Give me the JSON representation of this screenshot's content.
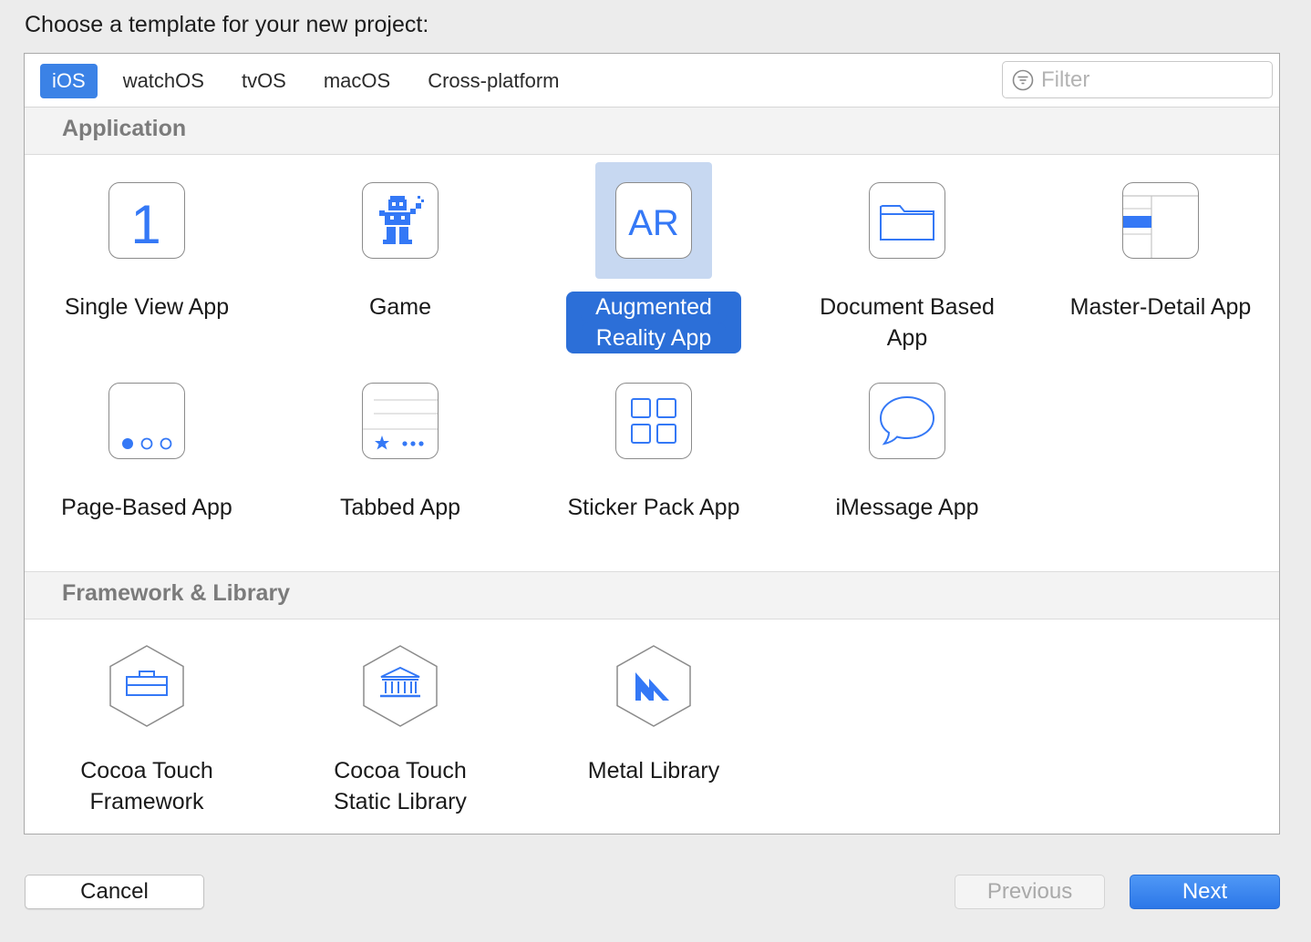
{
  "prompt": "Choose a template for your new project:",
  "tabs": [
    {
      "label": "iOS",
      "active": true
    },
    {
      "label": "watchOS",
      "active": false
    },
    {
      "label": "tvOS",
      "active": false
    },
    {
      "label": "macOS",
      "active": false
    },
    {
      "label": "Cross-platform",
      "active": false
    }
  ],
  "filter": {
    "placeholder": "Filter",
    "value": ""
  },
  "sections": {
    "application": {
      "title": "Application",
      "items": [
        {
          "line1": "Single View App",
          "line2": "",
          "icon": "single-view-icon",
          "glyph": "1"
        },
        {
          "line1": "Game",
          "line2": "",
          "icon": "game-icon"
        },
        {
          "line1": "Augmented",
          "line2": "Reality App",
          "icon": "ar-icon",
          "glyph": "AR",
          "selected": true
        },
        {
          "line1": "Document Based",
          "line2": "App",
          "icon": "folder-icon"
        },
        {
          "line1": "Master-Detail App",
          "line2": "",
          "icon": "master-detail-icon"
        },
        {
          "line1": "Page-Based App",
          "line2": "",
          "icon": "page-dots-icon"
        },
        {
          "line1": "Tabbed App",
          "line2": "",
          "icon": "tab-bar-icon"
        },
        {
          "line1": "Sticker Pack App",
          "line2": "",
          "icon": "sticker-grid-icon"
        },
        {
          "line1": "iMessage App",
          "line2": "",
          "icon": "speech-bubble-icon"
        }
      ]
    },
    "framework": {
      "title": "Framework & Library",
      "items": [
        {
          "line1": "Cocoa Touch",
          "line2": "Framework",
          "icon": "toolbox-icon"
        },
        {
          "line1": "Cocoa Touch",
          "line2": "Static Library",
          "icon": "library-building-icon"
        },
        {
          "line1": "Metal Library",
          "line2": "",
          "icon": "metal-icon"
        }
      ]
    }
  },
  "buttons": {
    "cancel": "Cancel",
    "previous": "Previous",
    "next": "Next",
    "previous_enabled": false
  },
  "colors": {
    "accent": "#3b82e6",
    "selection_label": "#2c6fd8",
    "selection_icon_bg": "#c7d8f1",
    "icon_blue": "#3478f6"
  }
}
